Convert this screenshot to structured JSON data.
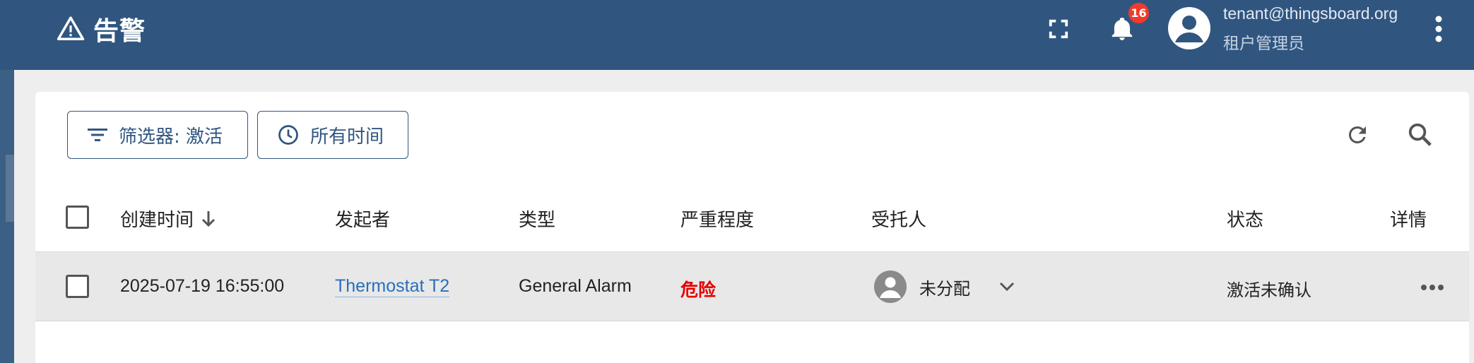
{
  "header": {
    "title": "告警",
    "notification_count": "16",
    "user_email": "tenant@thingsboard.org",
    "user_role": "租户管理员"
  },
  "toolbar": {
    "filter_label": "筛选器: 激活",
    "time_label": "所有时间"
  },
  "table": {
    "columns": {
      "created_time": "创建时间",
      "originator": "发起者",
      "type": "类型",
      "severity": "严重程度",
      "assignee": "受托人",
      "status": "状态",
      "details": "详情"
    },
    "rows": [
      {
        "created_time": "2025-07-19 16:55:00",
        "originator": "Thermostat T2",
        "type": "General Alarm",
        "severity": "危险",
        "assignee": "未分配",
        "status": "激活未确认"
      }
    ]
  },
  "colors": {
    "primary": "#305680",
    "severity_critical": "#e60000",
    "link": "#2a6ebb",
    "badge": "#ef3b2c"
  },
  "icons": [
    "warning-icon",
    "fullscreen-icon",
    "bell-icon",
    "account-circle-icon",
    "more-vert-icon",
    "filter-icon",
    "clock-icon",
    "refresh-icon",
    "search-icon",
    "arrow-down-icon",
    "chevron-down-icon",
    "more-horiz-icon"
  ]
}
